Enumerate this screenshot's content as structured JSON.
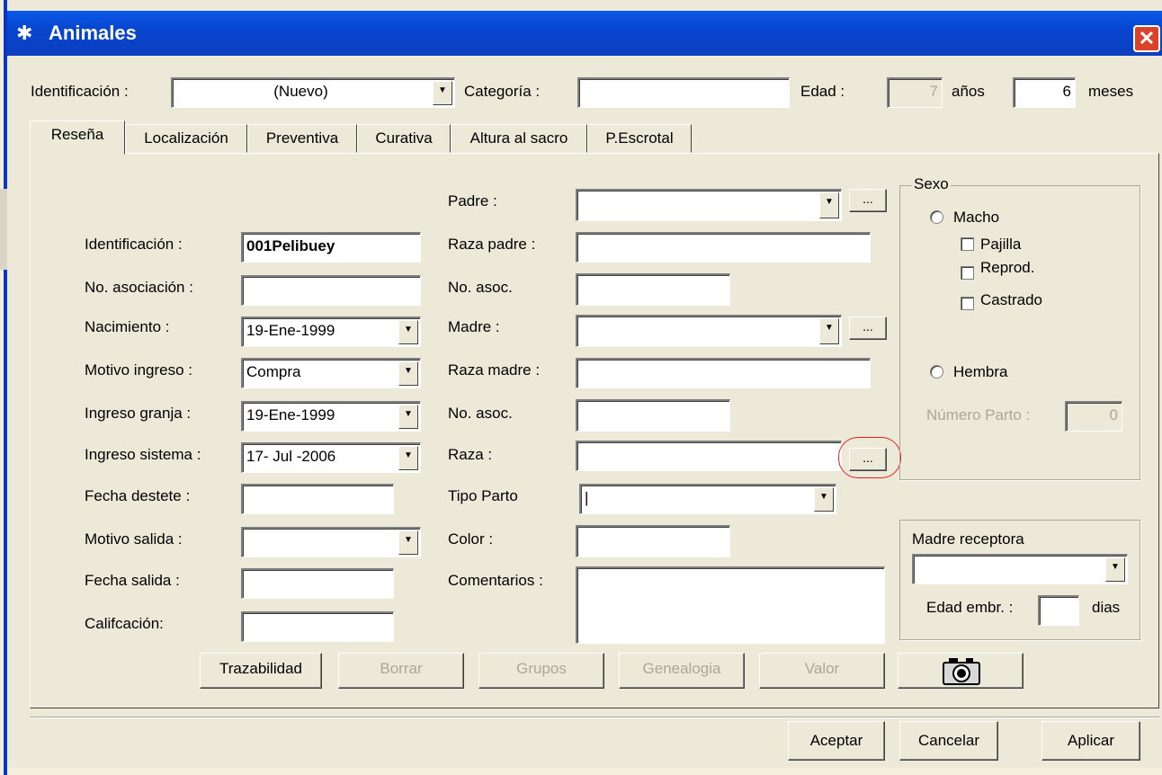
{
  "window": {
    "title": "Animales",
    "close_label": "✕"
  },
  "header": {
    "identificacion_label": "Identificación :",
    "identificacion_value": "(Nuevo)",
    "categoria_label": "Categoría :",
    "categoria_value": "",
    "edad_label": "Edad :",
    "edad_years": "7",
    "years_label": "años",
    "edad_months": "6",
    "months_label": "meses"
  },
  "tabs": [
    {
      "label": "Reseña",
      "active": true
    },
    {
      "label": "Localización"
    },
    {
      "label": "Preventiva"
    },
    {
      "label": "Curativa"
    },
    {
      "label": "Altura al sacro"
    },
    {
      "label": "P.Escrotal"
    }
  ],
  "left": {
    "identificacion_label": "Identificación :",
    "identificacion_value": "001Pelibuey",
    "asociacion_label": "No. asociación :",
    "asociacion_value": "",
    "nacimiento_label": "Nacimiento :",
    "nacimiento_value": "19-Ene-1999",
    "motivo_ingreso_label": "Motivo ingreso :",
    "motivo_ingreso_value": "Compra",
    "ingreso_granja_label": "Ingreso granja :",
    "ingreso_granja_value": "19-Ene-1999",
    "ingreso_sistema_label": "Ingreso sistema :",
    "ingreso_sistema_value": "17- Jul -2006",
    "fecha_destete_label": "Fecha destete :",
    "fecha_destete_value": "",
    "motivo_salida_label": "Motivo salida :",
    "motivo_salida_value": "",
    "fecha_salida_label": "Fecha salida :",
    "fecha_salida_value": "",
    "calificacion_label": "Califcación:",
    "calificacion_value": ""
  },
  "middle": {
    "padre_label": "Padre :",
    "padre_value": "",
    "raza_padre_label": "Raza padre :",
    "raza_padre_value": "",
    "no_asoc_label": "No. asoc.",
    "no_asoc_padre_value": "",
    "madre_label": "Madre :",
    "madre_value": "",
    "raza_madre_label": "Raza madre :",
    "raza_madre_value": "",
    "no_asoc_madre_value": "",
    "raza_label": "Raza :",
    "raza_value": "",
    "tipo_parto_label": "Tipo Parto",
    "tipo_parto_value": "|",
    "color_label": "Color :",
    "color_value": "",
    "comentarios_label": "Comentarios :",
    "comentarios_value": "",
    "ellipsis": "..."
  },
  "sexo": {
    "group_label": "Sexo",
    "macho_label": "Macho",
    "pajilla_label": "Pajilla",
    "reprod_label": "Reprod.",
    "castrado_label": "Castrado",
    "hembra_label": "Hembra",
    "numero_parto_label": "Número Parto :",
    "numero_parto_value": "0"
  },
  "receptora": {
    "group_label": "Madre receptora",
    "value": "",
    "edad_embr_label": "Edad embr. :",
    "edad_embr_value": "",
    "dias_label": "dias"
  },
  "action_buttons": {
    "trazabilidad": "Trazabilidad",
    "borrar": "Borrar",
    "grupos": "Grupos",
    "genealogia": "Genealogia",
    "valor": "Valor"
  },
  "footer": {
    "aceptar": "Aceptar",
    "cancelar": "Cancelar",
    "aplicar": "Aplicar"
  },
  "dropdown_glyph": "▼"
}
